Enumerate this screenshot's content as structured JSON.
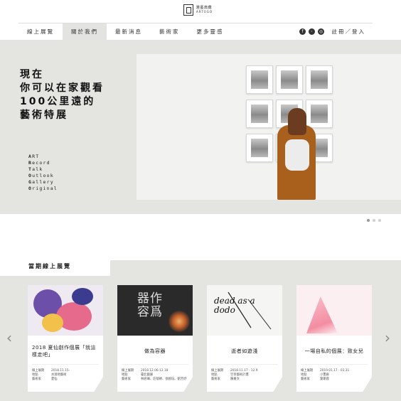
{
  "logo": {
    "zh": "雅藝典藏",
    "en": "ARTOGO"
  },
  "nav": {
    "items": [
      {
        "label": "線上展覽",
        "active": false
      },
      {
        "label": "關於我們",
        "active": true
      },
      {
        "label": "最新消息",
        "active": false
      },
      {
        "label": "藝術家",
        "active": false
      },
      {
        "label": "更多靈感",
        "active": false
      }
    ],
    "social_icons": [
      "facebook-icon",
      "line-icon",
      "instagram-icon"
    ],
    "login_label": "註冊／登入"
  },
  "hero": {
    "heading": "現在\n你可以在家觀看\n100公里遠的\n藝術特展",
    "acronym": [
      {
        "initial": "A",
        "rest": "RT"
      },
      {
        "initial": "R",
        "rest": "ecord"
      },
      {
        "initial": "T",
        "rest": "alk"
      },
      {
        "initial": "O",
        "rest": "utlook"
      },
      {
        "initial": "G",
        "rest": "allery"
      },
      {
        "initial": "O",
        "rest": "riginal"
      }
    ],
    "slide_count": 3,
    "active_slide": 1
  },
  "exhibitions": {
    "section_title": "當期線上展覽",
    "cards": [
      {
        "title": "2018 夏仙創作個展「就這樣走吧」",
        "meta": [
          {
            "k": "線上展期",
            "v": "2018.11.15-"
          },
          {
            "k": "地點",
            "v": "水源地藝術"
          },
          {
            "k": "藝術家",
            "v": "夏仙"
          }
        ]
      },
      {
        "title": "做為容器",
        "poster_text": "器作\n容爲",
        "meta": [
          {
            "k": "線上展期",
            "v": "2018.12.06-12.18"
          },
          {
            "k": "地點",
            "v": "臺北藝廊"
          },
          {
            "k": "藝術家",
            "v": "林君峰、莊郁婷、張婉瑄、劉芳妤"
          }
        ]
      },
      {
        "title": "逝者如遊淺",
        "poster_text": "dead as a dodo",
        "meta": [
          {
            "k": "線上展期",
            "v": "2018.11.17 - 12.9"
          },
          {
            "k": "地點",
            "v": "空目藝術計畫"
          },
          {
            "k": "藝術家",
            "v": "陳嘉文"
          }
        ]
      },
      {
        "title": "一場自私的個展：致女兒",
        "meta": [
          {
            "k": "線上展期",
            "v": "2019.01.17 - 03.31"
          },
          {
            "k": "地點",
            "v": "小畫廊"
          },
          {
            "k": "藝術家",
            "v": "葉瑜蓉"
          }
        ]
      }
    ]
  },
  "colors": {
    "hero_bg": "#e4e4e0",
    "accent_text": "#222222"
  }
}
